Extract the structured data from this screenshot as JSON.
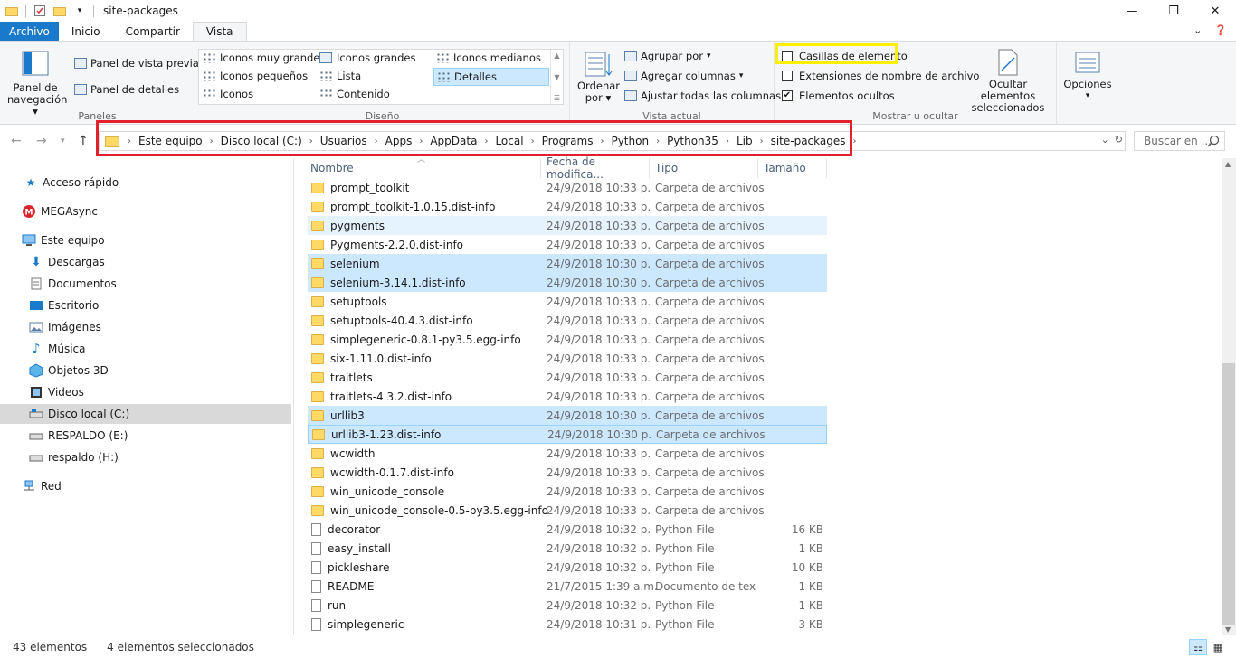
{
  "window": {
    "title": "site-packages"
  },
  "ribbon_tabs": [
    "Archivo",
    "Inicio",
    "Compartir",
    "Vista"
  ],
  "ribbon": {
    "paneles": {
      "label": "Paneles",
      "nav_pane_line1": "Panel de",
      "nav_pane_line2": "navegación",
      "preview": "Panel de vista previa",
      "details": "Panel de detalles"
    },
    "diseno": {
      "label": "Diseño",
      "items": [
        {
          "label": "Iconos muy grandes"
        },
        {
          "label": "Iconos grandes"
        },
        {
          "label": "Iconos medianos"
        },
        {
          "label": "Iconos pequeños"
        },
        {
          "label": "Lista"
        },
        {
          "label": "Detalles"
        },
        {
          "label": "Iconos"
        },
        {
          "label": "Contenido"
        }
      ]
    },
    "vista_actual": {
      "label": "Vista actual",
      "sort_line1": "Ordenar",
      "sort_line2": "por",
      "group_by": "Agrupar por",
      "add_columns": "Agregar columnas",
      "fit_columns": "Ajustar todas las columnas"
    },
    "mostrar": {
      "label": "Mostrar u ocultar",
      "item_checkboxes": "Casillas de elemento",
      "extensions": "Extensiones de nombre de archivo",
      "hidden_items": "Elementos ocultos",
      "hide_selected_line1": "Ocultar elementos",
      "hide_selected_line2": "seleccionados"
    },
    "options": "Opciones"
  },
  "breadcrumb": [
    "Este equipo",
    "Disco local (C:)",
    "Usuarios",
    "Apps",
    "AppData",
    "Local",
    "Programs",
    "Python",
    "Python35",
    "Lib",
    "site-packages"
  ],
  "search": {
    "placeholder": "Buscar en ..."
  },
  "nav_pane": [
    {
      "label": "Acceso rápido",
      "icon": "star-icon",
      "indent": 0
    },
    {
      "label": "MEGAsync",
      "icon": "mega-icon",
      "indent": 0
    },
    {
      "label": "Este equipo",
      "icon": "computer-icon",
      "indent": 0
    },
    {
      "label": "Descargas",
      "icon": "download-icon",
      "indent": 1
    },
    {
      "label": "Documentos",
      "icon": "documents-icon",
      "indent": 1
    },
    {
      "label": "Escritorio",
      "icon": "desktop-icon",
      "indent": 1
    },
    {
      "label": "Imágenes",
      "icon": "pictures-icon",
      "indent": 1
    },
    {
      "label": "Música",
      "icon": "music-icon",
      "indent": 1
    },
    {
      "label": "Objetos 3D",
      "icon": "objects-3d-icon",
      "indent": 1
    },
    {
      "label": "Videos",
      "icon": "videos-icon",
      "indent": 1
    },
    {
      "label": "Disco local (C:)",
      "icon": "drive-icon",
      "indent": 1
    },
    {
      "label": "RESPALDO (E:)",
      "icon": "drive-icon",
      "indent": 1
    },
    {
      "label": "respaldo (H:)",
      "icon": "drive-icon",
      "indent": 1
    },
    {
      "label": "Red",
      "icon": "network-icon",
      "indent": 0
    }
  ],
  "columns": [
    "Nombre",
    "Fecha de modifica...",
    "Tipo",
    "Tamaño"
  ],
  "files": [
    {
      "name": "prompt_toolkit",
      "date": "24/9/2018 10:33 p.",
      "type": "Carpeta de archivos",
      "size": "",
      "kind": "folder",
      "state": ""
    },
    {
      "name": "prompt_toolkit-1.0.15.dist-info",
      "date": "24/9/2018 10:33 p.",
      "type": "Carpeta de archivos",
      "size": "",
      "kind": "folder",
      "state": ""
    },
    {
      "name": "pygments",
      "date": "24/9/2018 10:33 p.",
      "type": "Carpeta de archivos",
      "size": "",
      "kind": "folder",
      "state": "hover"
    },
    {
      "name": "Pygments-2.2.0.dist-info",
      "date": "24/9/2018 10:33 p.",
      "type": "Carpeta de archivos",
      "size": "",
      "kind": "folder",
      "state": ""
    },
    {
      "name": "selenium",
      "date": "24/9/2018 10:30 p.",
      "type": "Carpeta de archivos",
      "size": "",
      "kind": "folder",
      "state": "sel"
    },
    {
      "name": "selenium-3.14.1.dist-info",
      "date": "24/9/2018 10:30 p.",
      "type": "Carpeta de archivos",
      "size": "",
      "kind": "folder",
      "state": "sel"
    },
    {
      "name": "setuptools",
      "date": "24/9/2018 10:33 p.",
      "type": "Carpeta de archivos",
      "size": "",
      "kind": "folder",
      "state": ""
    },
    {
      "name": "setuptools-40.4.3.dist-info",
      "date": "24/9/2018 10:33 p.",
      "type": "Carpeta de archivos",
      "size": "",
      "kind": "folder",
      "state": ""
    },
    {
      "name": "simplegeneric-0.8.1-py3.5.egg-info",
      "date": "24/9/2018 10:33 p.",
      "type": "Carpeta de archivos",
      "size": "",
      "kind": "folder",
      "state": ""
    },
    {
      "name": "six-1.11.0.dist-info",
      "date": "24/9/2018 10:33 p.",
      "type": "Carpeta de archivos",
      "size": "",
      "kind": "folder",
      "state": ""
    },
    {
      "name": "traitlets",
      "date": "24/9/2018 10:33 p.",
      "type": "Carpeta de archivos",
      "size": "",
      "kind": "folder",
      "state": ""
    },
    {
      "name": "traitlets-4.3.2.dist-info",
      "date": "24/9/2018 10:33 p.",
      "type": "Carpeta de archivos",
      "size": "",
      "kind": "folder",
      "state": ""
    },
    {
      "name": "urllib3",
      "date": "24/9/2018 10:30 p.",
      "type": "Carpeta de archivos",
      "size": "",
      "kind": "folder",
      "state": "sel"
    },
    {
      "name": "urllib3-1.23.dist-info",
      "date": "24/9/2018 10:30 p.",
      "type": "Carpeta de archivos",
      "size": "",
      "kind": "folder",
      "state": "focus"
    },
    {
      "name": "wcwidth",
      "date": "24/9/2018 10:33 p.",
      "type": "Carpeta de archivos",
      "size": "",
      "kind": "folder",
      "state": ""
    },
    {
      "name": "wcwidth-0.1.7.dist-info",
      "date": "24/9/2018 10:33 p.",
      "type": "Carpeta de archivos",
      "size": "",
      "kind": "folder",
      "state": ""
    },
    {
      "name": "win_unicode_console",
      "date": "24/9/2018 10:33 p.",
      "type": "Carpeta de archivos",
      "size": "",
      "kind": "folder",
      "state": ""
    },
    {
      "name": "win_unicode_console-0.5-py3.5.egg-info",
      "date": "24/9/2018 10:33 p.",
      "type": "Carpeta de archivos",
      "size": "",
      "kind": "folder",
      "state": ""
    },
    {
      "name": "decorator",
      "date": "24/9/2018 10:32 p.",
      "type": "Python File",
      "size": "16 KB",
      "kind": "file",
      "state": ""
    },
    {
      "name": "easy_install",
      "date": "24/9/2018 10:32 p.",
      "type": "Python File",
      "size": "1 KB",
      "kind": "file",
      "state": ""
    },
    {
      "name": "pickleshare",
      "date": "24/9/2018 10:32 p.",
      "type": "Python File",
      "size": "10 KB",
      "kind": "file",
      "state": ""
    },
    {
      "name": "README",
      "date": "21/7/2015 1:39 a.m.",
      "type": "Documento de tex",
      "size": "1 KB",
      "kind": "file",
      "state": ""
    },
    {
      "name": "run",
      "date": "24/9/2018 10:32 p.",
      "type": "Python File",
      "size": "1 KB",
      "kind": "file",
      "state": ""
    },
    {
      "name": "simplegeneric",
      "date": "24/9/2018 10:31 p.",
      "type": "Python File",
      "size": "3 KB",
      "kind": "file",
      "state": ""
    }
  ],
  "status": {
    "count": "43 elementos",
    "selected": "4 elementos seleccionados"
  }
}
